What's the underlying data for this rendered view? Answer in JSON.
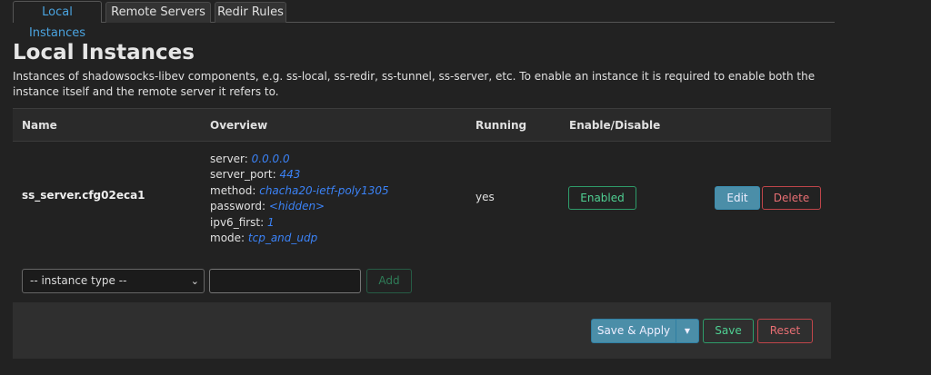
{
  "tabs": [
    {
      "label": "Local Instances",
      "active": true
    },
    {
      "label": "Remote Servers",
      "active": false
    },
    {
      "label": "Redir Rules",
      "active": false
    }
  ],
  "page": {
    "title": "Local Instances",
    "description": "Instances of shadowsocks-libev components, e.g. ss-local, ss-redir, ss-tunnel, ss-server, etc. To enable an instance it is required to enable both the instance itself and the remote server it refers to."
  },
  "table": {
    "headers": {
      "name": "Name",
      "overview": "Overview",
      "running": "Running",
      "enable": "Enable/Disable"
    },
    "rows": [
      {
        "name": "ss_server.cfg02eca1",
        "overview": [
          {
            "key": "server:",
            "value": "0.0.0.0"
          },
          {
            "key": "server_port:",
            "value": "443"
          },
          {
            "key": "method:",
            "value": "chacha20-ietf-poly1305"
          },
          {
            "key": "password:",
            "value": "<hidden>"
          },
          {
            "key": "ipv6_first:",
            "value": "1"
          },
          {
            "key": "mode:",
            "value": "tcp_and_udp"
          }
        ],
        "running": "yes",
        "enable_label": "Enabled",
        "edit_label": "Edit",
        "delete_label": "Delete"
      }
    ]
  },
  "add_row": {
    "select_value": "-- instance type --",
    "add_label": "Add"
  },
  "footer": {
    "save_apply_label": "Save & Apply",
    "save_label": "Save",
    "reset_label": "Reset"
  },
  "icons": {
    "dropdown": "chevron-down-icon",
    "caret": "caret-down-icon"
  },
  "colors": {
    "link": "#4aa3df",
    "value": "#3b82f6",
    "positive": "#4fcf92",
    "negative": "#e76e73",
    "primary": "#4b8ea8"
  }
}
